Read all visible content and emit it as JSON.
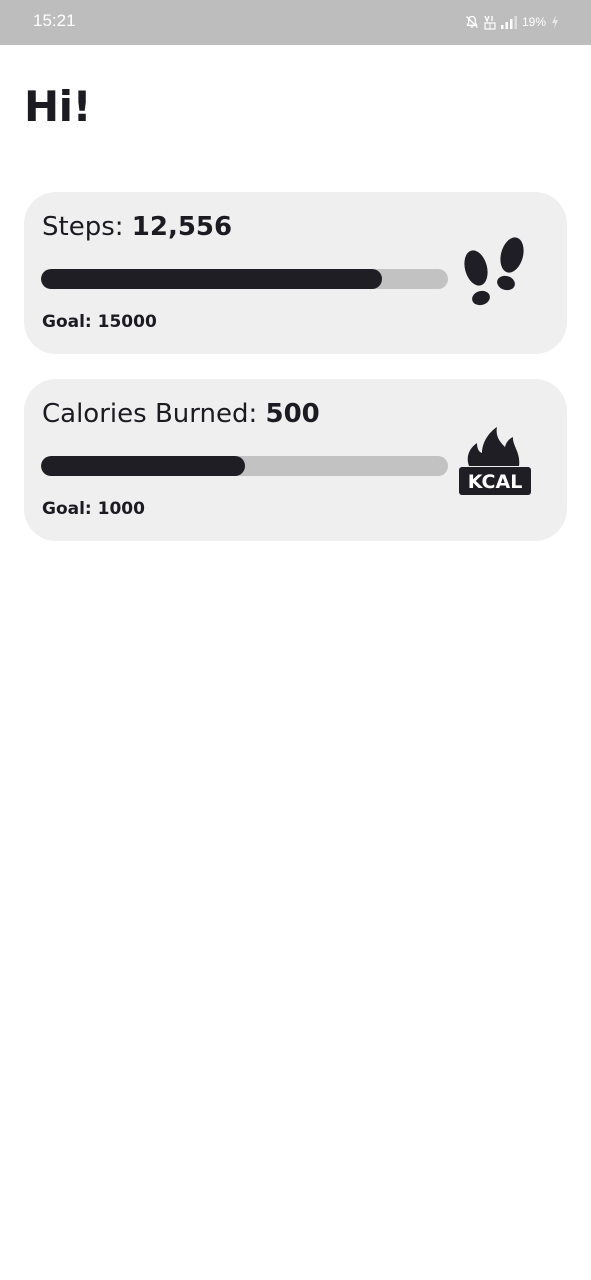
{
  "status_bar": {
    "time": "15:21",
    "battery": "19%",
    "icons": [
      "notifications-off-icon",
      "volte-icon",
      "signal-icon",
      "battery-charging-icon"
    ]
  },
  "greeting": "Hi!",
  "steps_card": {
    "label": "Steps:",
    "value": "12,556",
    "goal_text": "Goal: 15000",
    "progress": 0.837,
    "icon": "footprints-icon"
  },
  "calories_card": {
    "label": "Calories Burned:",
    "value": "500",
    "goal_text": "Goal: 1000",
    "progress": 0.5,
    "icon": "kcal-fire-icon",
    "icon_text": "KCAL"
  },
  "colors": {
    "status_bar_bg": "#bdbdbd",
    "card_bg": "#efefef",
    "progress_fill": "#1e1e24",
    "progress_track": "#c2c2c2",
    "text": "#1c1b21"
  }
}
